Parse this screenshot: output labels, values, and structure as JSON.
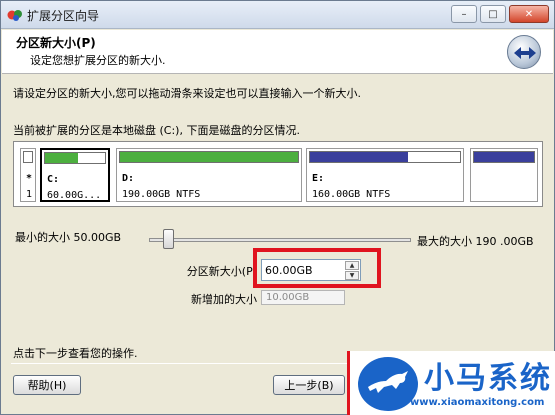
{
  "window": {
    "title": "扩展分区向导",
    "controls": {
      "minimize": "–",
      "maximize": "□",
      "close": "✕"
    }
  },
  "header": {
    "title": "分区新大小(P)",
    "subtitle": "设定您想扩展分区的新大小."
  },
  "instructions": {
    "line1": "请设定分区的新大小,您可以拖动滑条来设定也可以直接输入一个新大小.",
    "line2": "当前被扩展的分区是本地磁盘 (C:), 下面是磁盘的分区情况."
  },
  "partitions": [
    {
      "letter": "*",
      "info": "1",
      "fill_color": "#4caf3f",
      "used_fraction": 0.0
    },
    {
      "letter": "C:",
      "info": "60.00G...",
      "fill_color": "#4caf3f",
      "used_fraction": 0.55
    },
    {
      "letter": "D:",
      "info": "190.00GB NTFS",
      "fill_color": "#4caf3f",
      "used_fraction": 1.0
    },
    {
      "letter": "E:",
      "info": "160.00GB NTFS",
      "fill_color": "#3a3f9c",
      "used_fraction": 0.65
    },
    {
      "letter": "",
      "info": "",
      "fill_color": "#3a3f9c",
      "used_fraction": 1.0
    }
  ],
  "size": {
    "min_label": "最小的大小 50.00GB",
    "max_label": "最大的大小 190 .00GB",
    "new_size_label": "分区新大小(P)",
    "new_size_value": "60.00GB",
    "added_label": "新增加的大小",
    "added_value": "10.00GB"
  },
  "footer": {
    "hint": "点击下一步查看您的操作.",
    "help_label": "帮助(H)",
    "back_label": "上一步(B)"
  },
  "watermark": {
    "title": "小马系统",
    "url": "www.xiaomaxitong.com"
  }
}
